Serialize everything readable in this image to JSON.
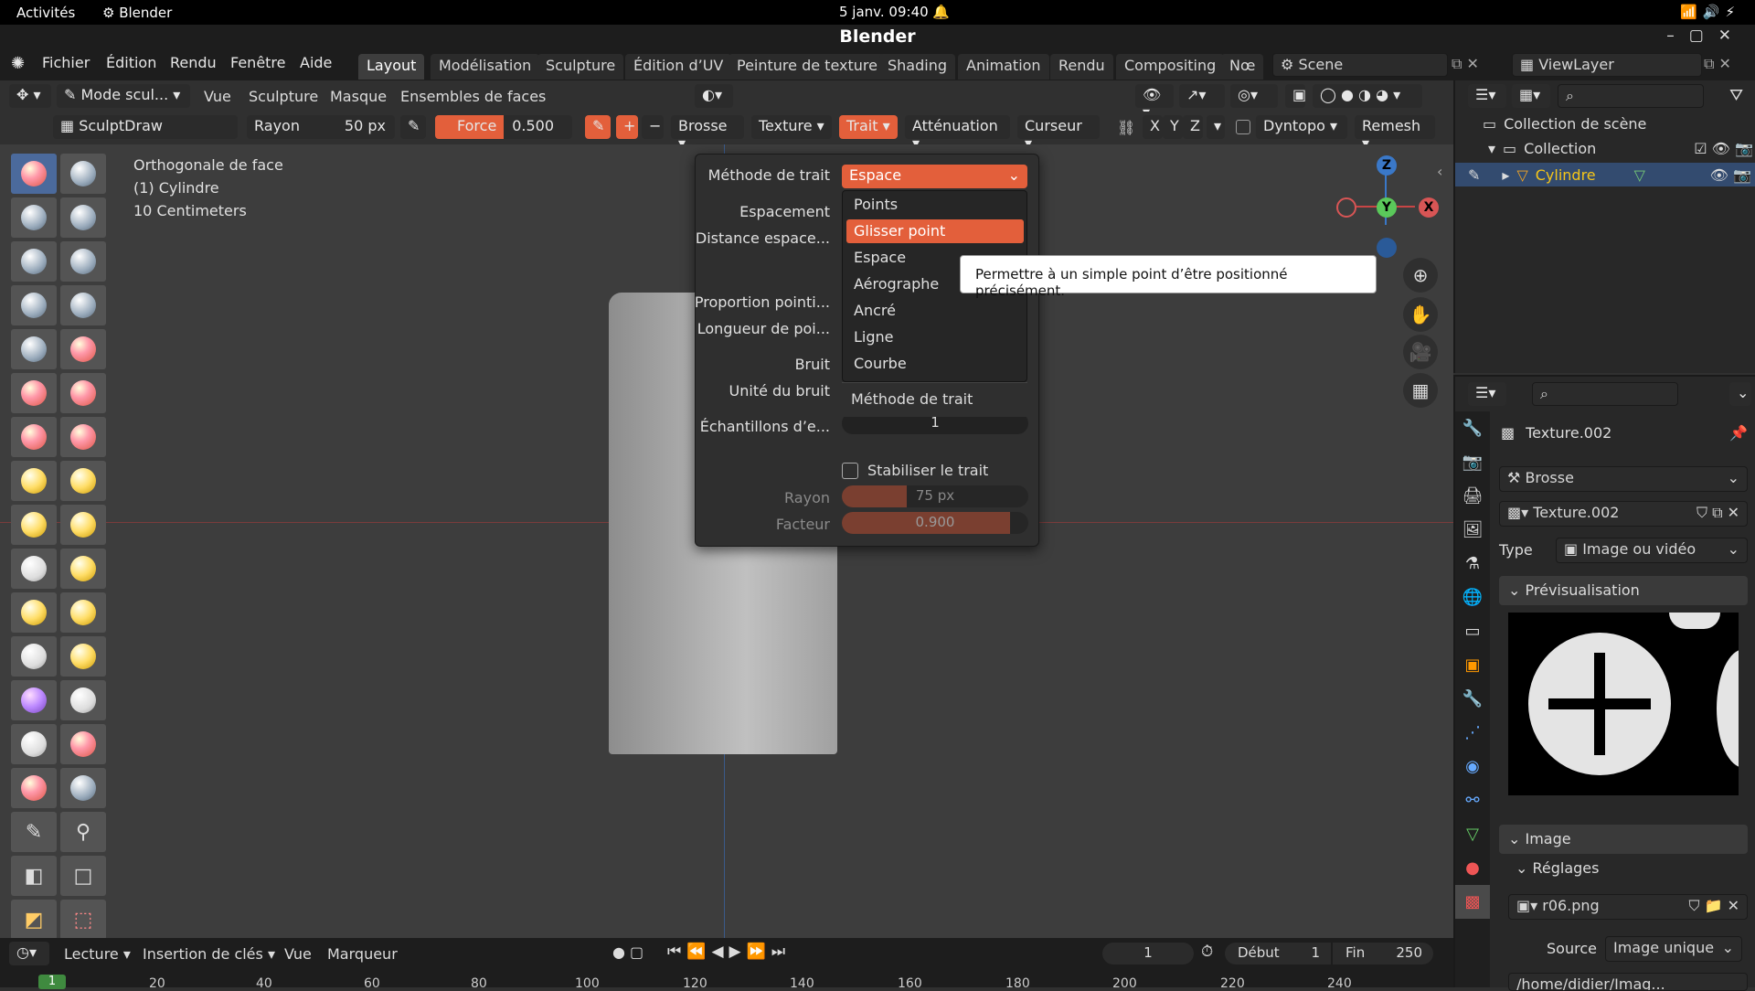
{
  "gnome": {
    "activities": "Activités",
    "app": "Blender",
    "clock": "5 janv.  09:40"
  },
  "window": {
    "title": "Blender"
  },
  "menus": [
    "Fichier",
    "Édition",
    "Rendu",
    "Fenêtre",
    "Aide"
  ],
  "workspaces": [
    "Layout",
    "Modélisation",
    "Sculpture",
    "Édition d’UV",
    "Peinture de texture",
    "Shading",
    "Animation",
    "Rendu",
    "Compositing",
    "Nœ"
  ],
  "scene": "Scene",
  "viewlayer": "ViewLayer",
  "header1": {
    "mode": "Mode scul...",
    "items": [
      "Vue",
      "Sculpture",
      "Masque",
      "Ensembles de faces"
    ]
  },
  "header2": {
    "brush_name": "SculptDraw",
    "radius_label": "Rayon",
    "radius_value": "50 px",
    "force_label": "Force",
    "force_value": "0.500",
    "dropdowns": [
      "Brosse",
      "Texture",
      "Trait",
      "Atténuation",
      "Curseur"
    ],
    "axes": [
      "X",
      "Y",
      "Z"
    ],
    "dyntopo": "Dyntopo",
    "remesh": "Remesh"
  },
  "viewport_info": [
    "Orthogonale de face",
    "(1) Cylindre",
    "10 Centimeters"
  ],
  "popover": {
    "method_label": "Méthode de trait",
    "method_value": "Espace",
    "labels": [
      "Espacement",
      "Distance espace...",
      "Proportion pointi...",
      "Longueur de poi...",
      "Bruit",
      "Unité du bruit",
      "Échantillons d’e..."
    ],
    "samples_value": "1",
    "stabilize": "Stabiliser le trait",
    "radius_label": "Rayon",
    "radius_value": "75 px",
    "radius_fill": 0.35,
    "factor_label": "Facteur",
    "factor_value": "0.900",
    "factor_fill": 0.9
  },
  "dropdown": {
    "items": [
      "Points",
      "Glisser point",
      "Espace",
      "Aérographe",
      "Ancré",
      "Ligne",
      "Courbe"
    ],
    "selected": "Glisser point",
    "footer": "Méthode de trait"
  },
  "tooltip": "Permettre à un simple point d’être positionné précisément.",
  "outliner": {
    "scene_collection": "Collection de scène",
    "collection": "Collection",
    "object": "Cylindre"
  },
  "properties": {
    "texture_name": "Texture.002",
    "brush_mode": "Brosse",
    "type_label": "Type",
    "type_value": "Image ou vidéo",
    "preview_label": "Prévisualisation",
    "image_label": "Image",
    "settings_label": "Réglages",
    "image_file": "r06.png",
    "source_label": "Source",
    "source_value": "Image unique",
    "path": "/home/didier/Imag..."
  },
  "timeline": {
    "menus": [
      "Lecture",
      "Insertion de clés",
      "Vue",
      "Marqueur"
    ],
    "current_frame": "1",
    "start_label": "Début",
    "start_value": "1",
    "end_label": "Fin",
    "end_value": "250",
    "ruler": [
      "20",
      "40",
      "60",
      "80",
      "100",
      "120",
      "140",
      "160",
      "180",
      "200",
      "220",
      "240"
    ],
    "frame_marker": "1"
  },
  "gizmo": {
    "z": "Z",
    "y": "Y",
    "x": "X"
  },
  "colors": {
    "accent": "#e35f3b",
    "selection": "#4b6a9c",
    "object_yellow": "#f5c518"
  }
}
